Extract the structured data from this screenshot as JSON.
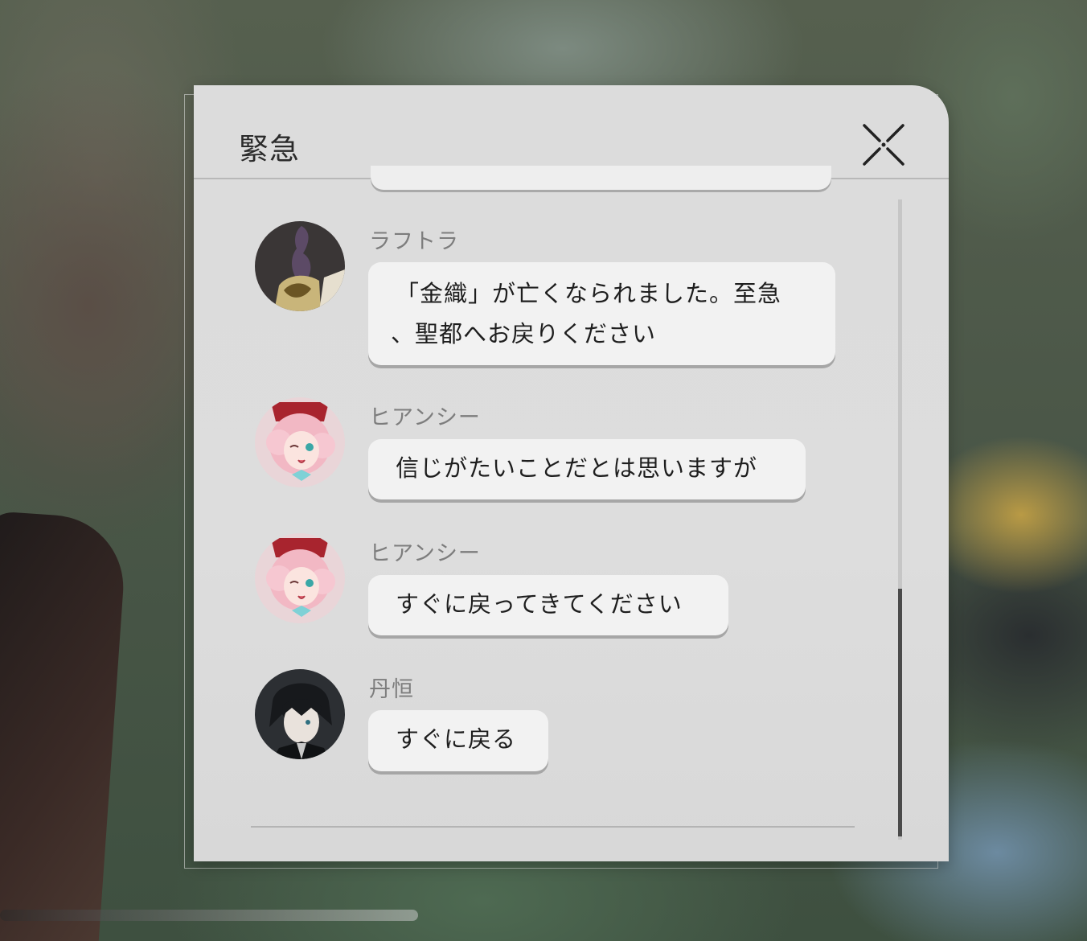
{
  "dialog": {
    "title": "緊急",
    "close_icon": "close-x-icon"
  },
  "messages": [
    {
      "sender": "ラフトラ",
      "text_lines": [
        "「金織」が亡くなられました。至急",
        "、聖都へお戻りください"
      ],
      "avatar_icon": "raftra-avatar"
    },
    {
      "sender": "ヒアンシー",
      "text": "信じがたいことだとは思いますが",
      "avatar_icon": "hyacine-avatar"
    },
    {
      "sender": "ヒアンシー",
      "text": "すぐに戻ってきてください",
      "avatar_icon": "hyacine-avatar"
    },
    {
      "sender": "丹恒",
      "text": "すぐに戻る",
      "avatar_icon": "danheng-avatar"
    }
  ],
  "colors": {
    "panel": "#dcdcdc",
    "bubble": "#f2f2f2",
    "sender_text": "#7d7d7d",
    "scroll_thumb": "#4a4a4a"
  }
}
